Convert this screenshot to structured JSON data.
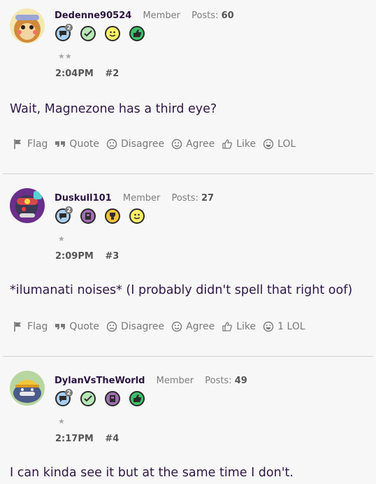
{
  "posts": [
    {
      "username": "Dedenne90524",
      "role": "Member",
      "posts_label": "Posts:",
      "posts_count": "60",
      "stars": "★★",
      "time": "2:04PM",
      "number": "#2",
      "body": "Wait, Magnezone has a third eye?",
      "badges": [
        "chat-badge-icon",
        "check-badge-icon",
        "smile-badge-icon",
        "thumbsup-badge-icon"
      ],
      "badge_count": "2",
      "actions": {
        "flag": "Flag",
        "quote": "Quote",
        "disagree": "Disagree",
        "agree": "Agree",
        "like": "Like",
        "lol": "LOL"
      }
    },
    {
      "username": "Duskull101",
      "role": "Member",
      "posts_label": "Posts:",
      "posts_count": "27",
      "stars": "★",
      "time": "2:09PM",
      "number": "#3",
      "body": "*ilumanati noises* (I probably didn't spell that right oof)",
      "badges": [
        "chat-badge-icon",
        "notebook-badge-icon",
        "trophy-badge-icon",
        "smile-badge-icon"
      ],
      "badge_count": "2",
      "actions": {
        "flag": "Flag",
        "quote": "Quote",
        "disagree": "Disagree",
        "agree": "Agree",
        "like": "Like",
        "lol": "1 LOL"
      }
    },
    {
      "username": "DylanVsTheWorld",
      "role": "Member",
      "posts_label": "Posts:",
      "posts_count": "49",
      "stars": "★",
      "time": "2:17PM",
      "number": "#4",
      "body": "I can kinda see it but at the same time I don't.",
      "badges": [
        "chat-badge-icon",
        "check-badge-icon",
        "notebook-badge-icon",
        "thumbsup-badge-icon"
      ],
      "badge_count": "2"
    }
  ],
  "colors": {
    "chat": "#a8cff0",
    "check": "#b7e7b7",
    "smile": "#fff06a",
    "thumbsup": "#3fbf6a",
    "notebook": "#a06fb0",
    "trophy": "#f3c13a"
  }
}
